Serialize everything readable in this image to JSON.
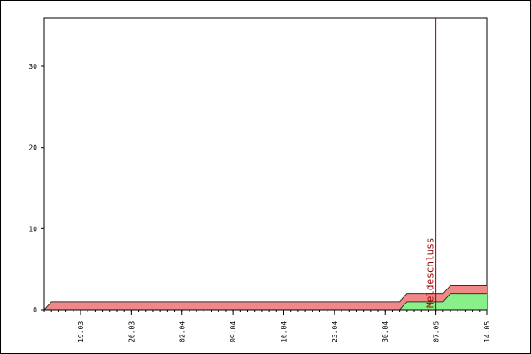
{
  "chart_data": {
    "type": "area",
    "title": "",
    "xlabel": "",
    "ylabel": "",
    "ylim": [
      0,
      36
    ],
    "grid": false,
    "x_start": "2025-03-14",
    "x_end": "2025-05-14",
    "x_tick_labels": [
      "19.03.",
      "26.03.",
      "02.04.",
      "09.04.",
      "16.04.",
      "23.04.",
      "30.04.",
      "07.05.",
      "14.05."
    ],
    "x_tick_dates": [
      "2025-03-19",
      "2025-03-26",
      "2025-04-02",
      "2025-04-09",
      "2025-04-16",
      "2025-04-23",
      "2025-04-30",
      "2025-05-07",
      "2025-05-14"
    ],
    "y_tick_labels": [
      "0",
      "10",
      "20",
      "30"
    ],
    "y_ticks": [
      0,
      10,
      20,
      30
    ],
    "series": [
      {
        "color": "#88f088",
        "stroke": "#333333",
        "points": [
          [
            "2025-03-14",
            0
          ],
          [
            "2025-05-02",
            0
          ],
          [
            "2025-05-03",
            1
          ],
          [
            "2025-05-08",
            1
          ],
          [
            "2025-05-09",
            2
          ],
          [
            "2025-05-14",
            2
          ]
        ]
      },
      {
        "color": "#f08888",
        "stroke": "#333333",
        "points": [
          [
            "2025-03-14",
            0
          ],
          [
            "2025-03-15",
            1
          ],
          [
            "2025-05-02",
            1
          ],
          [
            "2025-05-03",
            2
          ],
          [
            "2025-05-08",
            2
          ],
          [
            "2025-05-09",
            3
          ],
          [
            "2025-05-14",
            3
          ]
        ]
      }
    ],
    "annotations": [
      {
        "type": "vline",
        "date": "2025-05-07",
        "label": "Meldeschluss",
        "color": "#990000"
      }
    ]
  }
}
